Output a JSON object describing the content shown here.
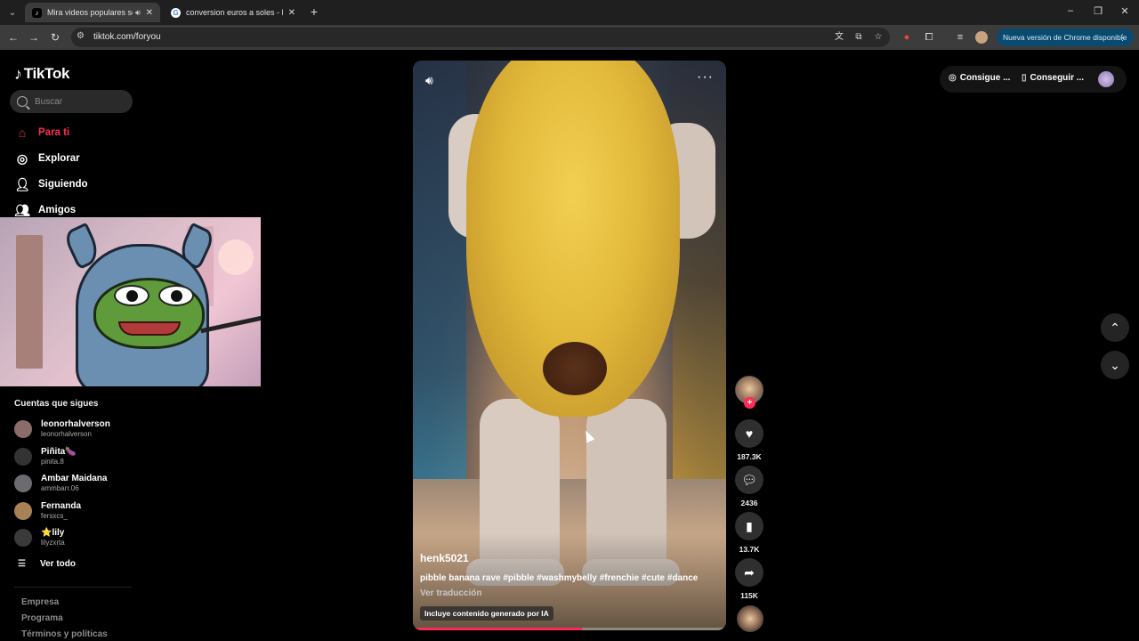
{
  "browser": {
    "tabs": [
      {
        "title": "Mira videos populares selec",
        "active": true,
        "audio": true
      },
      {
        "title": "conversion euros a soles - Busc",
        "active": false,
        "audio": false
      }
    ],
    "url": "tiktok.com/foryou",
    "update_label": "Nueva versión de Chrome disponible"
  },
  "sidebar": {
    "brand": "TikTok",
    "search_placeholder": "Buscar",
    "nav": [
      {
        "label": "Para ti",
        "icon": "home-icon",
        "active": true
      },
      {
        "label": "Explorar",
        "icon": "compass-icon",
        "active": false
      },
      {
        "label": "Siguiendo",
        "icon": "following-icon",
        "active": false
      },
      {
        "label": "Amigos",
        "icon": "friends-icon",
        "active": false
      }
    ],
    "following_title": "Cuentas que sigues",
    "accounts": [
      {
        "name": "leonorhalverson",
        "handle": "leonorhalverson",
        "color": "#8a6d6a"
      },
      {
        "name": "Piñita🍆",
        "handle": "pinita.8",
        "color": "#333333"
      },
      {
        "name": "Ambar Maidana",
        "handle": "ammbarr.06",
        "color": "#6b6b70"
      },
      {
        "name": "Fernanda",
        "handle": "fersxcs_",
        "color": "#a88256"
      },
      {
        "name": "⭐lily",
        "handle": "lilyzxrta",
        "color": "#3a3a3a"
      }
    ],
    "see_all": "Ver todo",
    "footer": [
      "Empresa",
      "Programa",
      "Términos y políticas"
    ]
  },
  "video": {
    "author": "henk5021",
    "caption": "pibble banana rave #pibble #washmybelly #frenchie #cute #dance",
    "translate": "Ver traducción",
    "ai_label": "Incluye contenido generado por IA",
    "progress": 0.54
  },
  "actions": {
    "likes": "187.3K",
    "comments": "2436",
    "saves": "13.7K",
    "shares": "115K"
  },
  "topbar": {
    "coins_label": "Consigue ...",
    "app_label": "Conseguir ..."
  },
  "colors": {
    "accent": "#fe2c55",
    "update_bg": "#0b4a6f"
  }
}
